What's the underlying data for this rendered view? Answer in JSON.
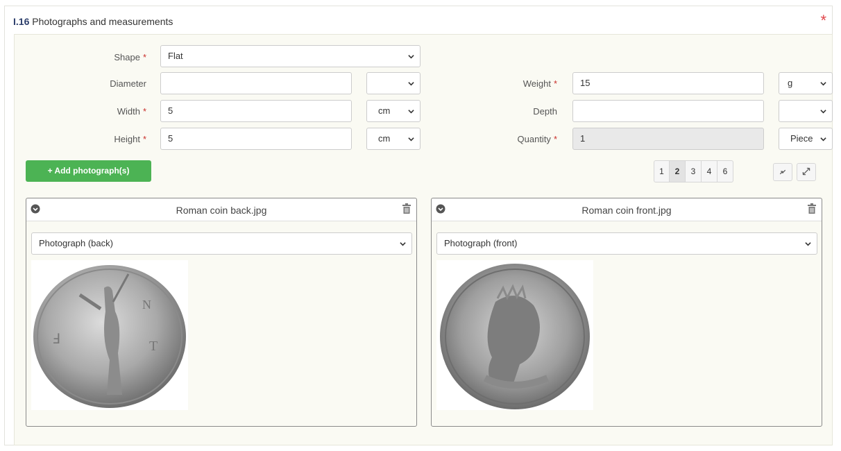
{
  "section": {
    "number": "I.16",
    "title": "Photographs and measurements",
    "required_marker": "*"
  },
  "form": {
    "required_marker": "*",
    "shape": {
      "label": "Shape",
      "value": "Flat"
    },
    "diameter": {
      "label": "Diameter",
      "value": "",
      "unit": ""
    },
    "width": {
      "label": "Width",
      "value": "5",
      "unit": "cm"
    },
    "height": {
      "label": "Height",
      "value": "5",
      "unit": "cm"
    },
    "weight": {
      "label": "Weight",
      "value": "15",
      "unit": "g"
    },
    "depth": {
      "label": "Depth",
      "value": "",
      "unit": ""
    },
    "quantity": {
      "label": "Quantity",
      "value": "1",
      "unit": "Piece"
    }
  },
  "add_button": {
    "icon": "plus-icon",
    "label": "+ Add photograph(s)"
  },
  "pagination": {
    "pages": [
      "1",
      "2",
      "3",
      "4",
      "6"
    ],
    "active": "2"
  },
  "zoom_controls": [
    "shrink-icon",
    "expand-icon"
  ],
  "photos": [
    {
      "filename": "Roman coin back.jpg",
      "type": "Photograph (back)"
    },
    {
      "filename": "Roman coin front.jpg",
      "type": "Photograph (front)"
    }
  ],
  "colors": {
    "accent_green": "#4cb354",
    "required_red": "#c9302c",
    "panel_bg": "#fafaf3"
  }
}
